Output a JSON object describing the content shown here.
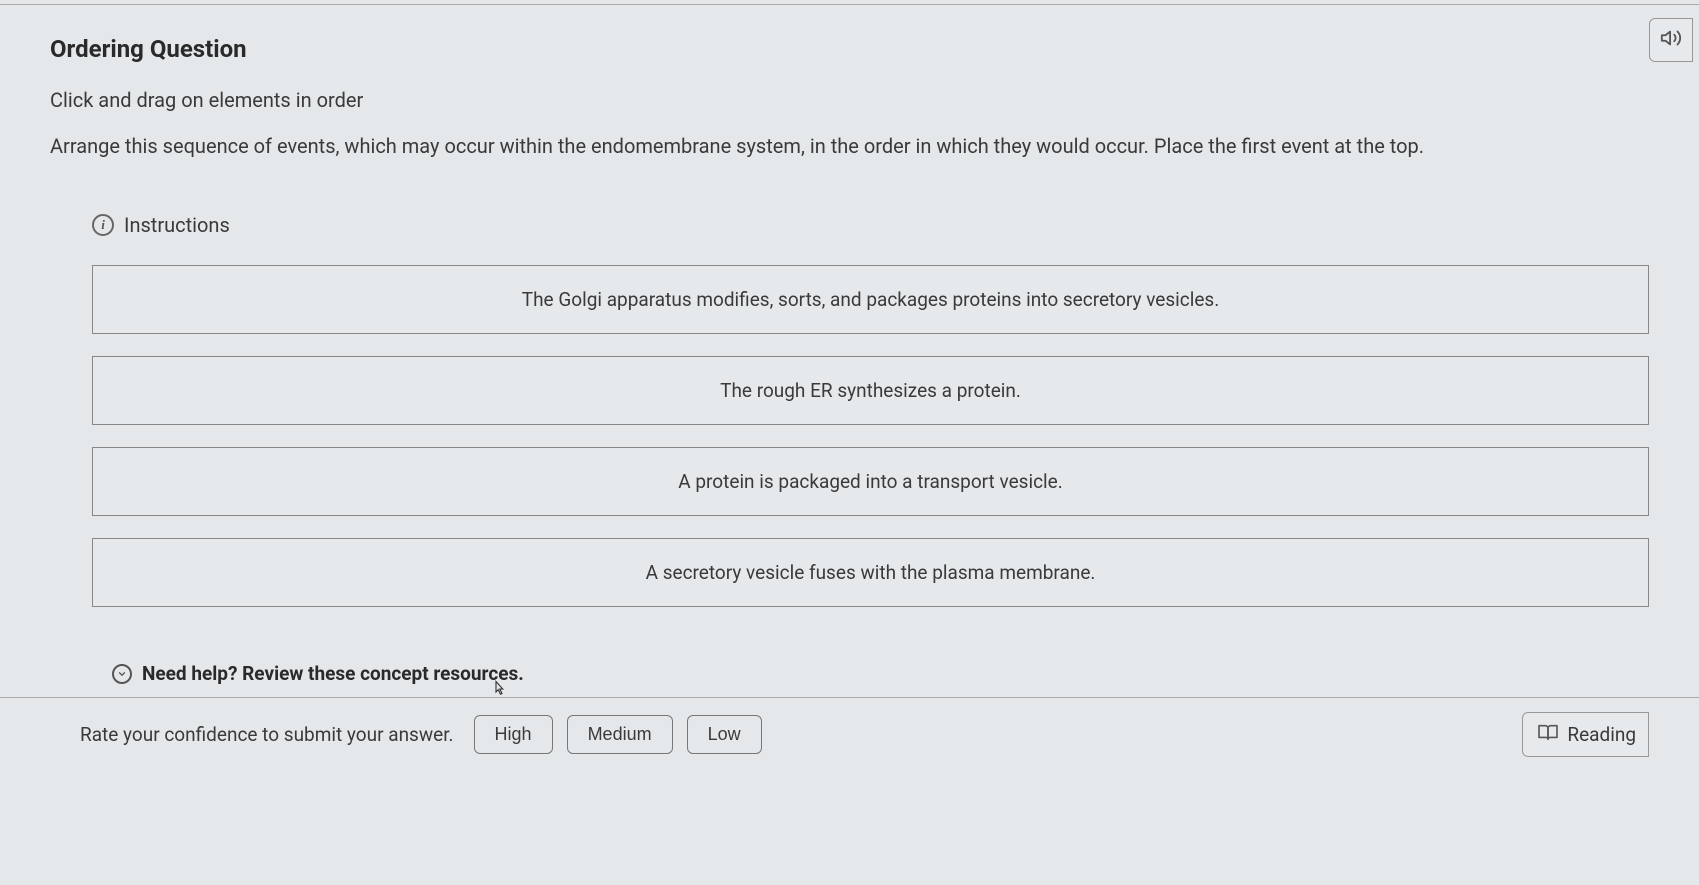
{
  "header": {
    "title": "Ordering Question",
    "instruction": "Click and drag on elements in order",
    "prompt": "Arrange this sequence of events, which may occur within the endomembrane system, in the order in which they would occur. Place the first event at the top."
  },
  "instructions_label": "Instructions",
  "items": [
    "The Golgi apparatus modifies, sorts, and packages proteins into secretory vesicles.",
    "The rough ER synthesizes a protein.",
    "A protein is packaged into a transport vesicle.",
    "A secretory vesicle fuses with the plasma membrane."
  ],
  "help": {
    "text": "Need help? Review these concept resources."
  },
  "footer": {
    "rate_label": "Rate your confidence to submit your answer.",
    "high": "High",
    "medium": "Medium",
    "low": "Low",
    "reading": "Reading"
  }
}
